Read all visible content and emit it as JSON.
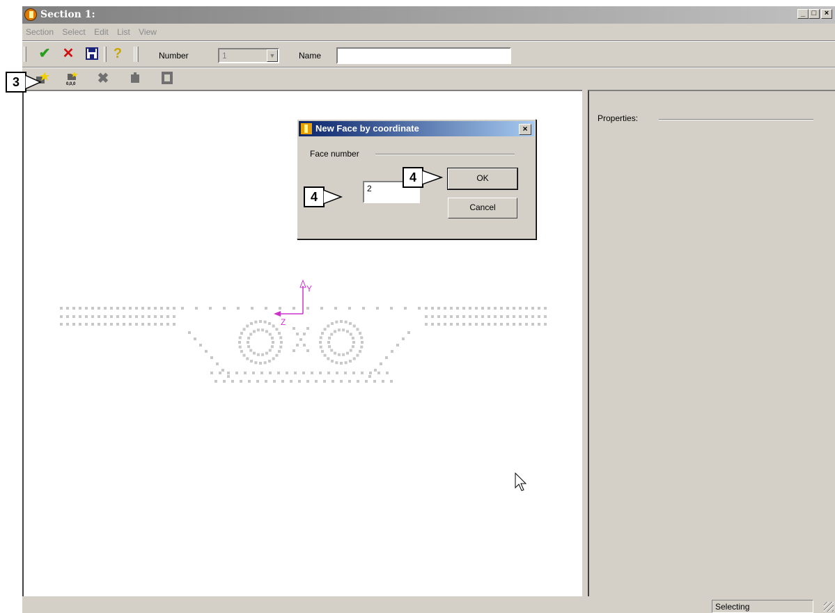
{
  "window": {
    "title": "Section 1:"
  },
  "menu": [
    "Section",
    "Select",
    "Edit",
    "List",
    "View"
  ],
  "toolbar": {
    "number_label": "Number",
    "number_value": "1",
    "name_label": "Name",
    "name_value": "",
    "icons": [
      "ok-check-icon",
      "cancel-x-icon",
      "save-disk-icon",
      "help-bulb-icon"
    ]
  },
  "toolbar2": {
    "icons": [
      "new-face-icon",
      "new-face-coordinate-icon",
      "delete-face-icon",
      "face-icon",
      "face-frame-icon"
    ]
  },
  "canvas": {
    "axis_y": "Y",
    "axis_z": "Z"
  },
  "properties": {
    "label": "Properties:"
  },
  "status": {
    "text": "Selecting"
  },
  "dialog": {
    "title": "New Face by coordinate",
    "group_label": "Face number",
    "face_number": "2",
    "ok_label": "OK",
    "cancel_label": "Cancel"
  },
  "callouts": {
    "step3": "3",
    "step4a": "4",
    "step4b": "4"
  },
  "colors": {
    "axis": "#cc33cc",
    "points": "#c8c8c8",
    "dialog_title": "#0a246a"
  }
}
